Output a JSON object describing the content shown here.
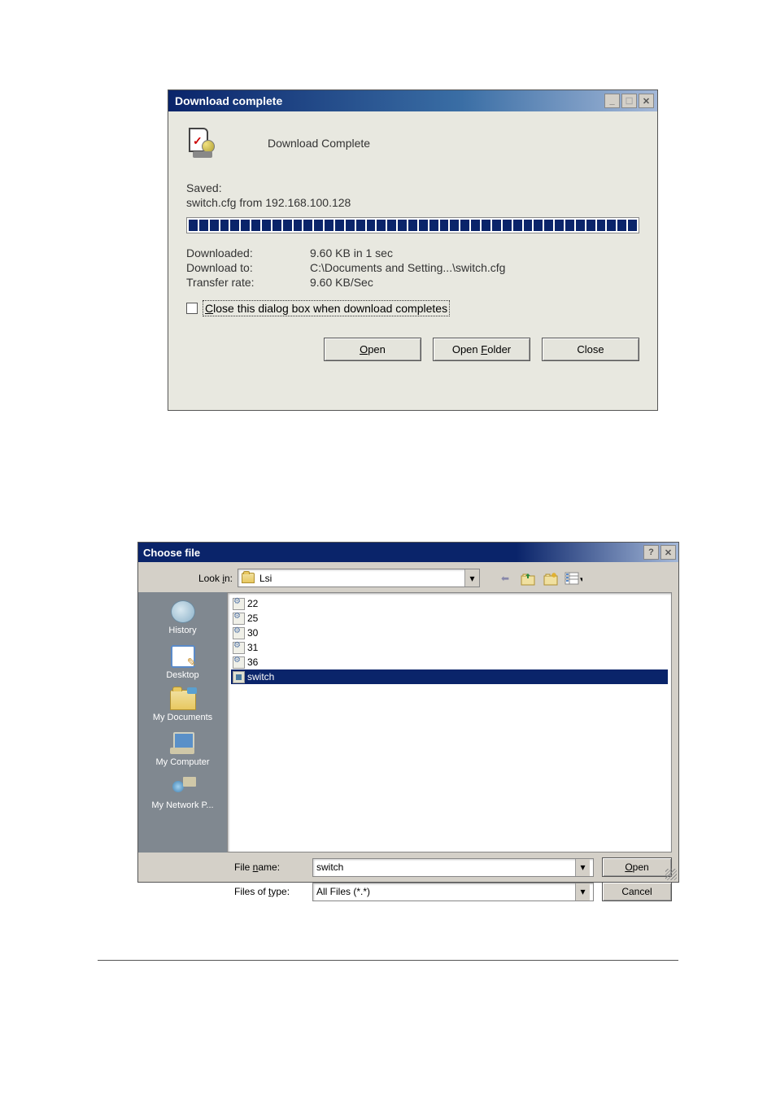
{
  "dialog1": {
    "title": "Download complete",
    "subtitle": "Download Complete",
    "saved_label": "Saved:",
    "saved_value": "switch.cfg from 192.168.100.128",
    "downloaded_label": "Downloaded:",
    "downloaded_value": "9.60 KB in 1 sec",
    "downloadto_label": "Download to:",
    "downloadto_value": "C:\\Documents and Setting...\\switch.cfg",
    "transferrate_label": "Transfer rate:",
    "transferrate_value": "9.60 KB/Sec",
    "checkbox_label": "Close this dialog box when download completes",
    "btn_open": "Open",
    "btn_open_u": "O",
    "btn_openfolder_pre": "Open ",
    "btn_openfolder_u": "F",
    "btn_openfolder_post": "older",
    "btn_close": "Close"
  },
  "dialog2": {
    "title": "Choose file",
    "lookin_label_pre": "Look ",
    "lookin_label_u": "i",
    "lookin_label_post": "n:",
    "lookin_value": "Lsi",
    "places": {
      "history": "History",
      "desktop": "Desktop",
      "mydocs": "My Documents",
      "mycomp": "My Computer",
      "mynet": "My Network P..."
    },
    "files": [
      "22",
      "25",
      "30",
      "31",
      "36"
    ],
    "selected_file": "switch",
    "filename_label_pre": "File ",
    "filename_label_u": "n",
    "filename_label_post": "ame:",
    "filename_value": "switch",
    "filetype_label_pre": "Files of ",
    "filetype_label_u": "t",
    "filetype_label_post": "ype:",
    "filetype_value": "All Files (*.*)",
    "btn_open_u": "O",
    "btn_open_post": "pen",
    "btn_cancel": "Cancel"
  }
}
